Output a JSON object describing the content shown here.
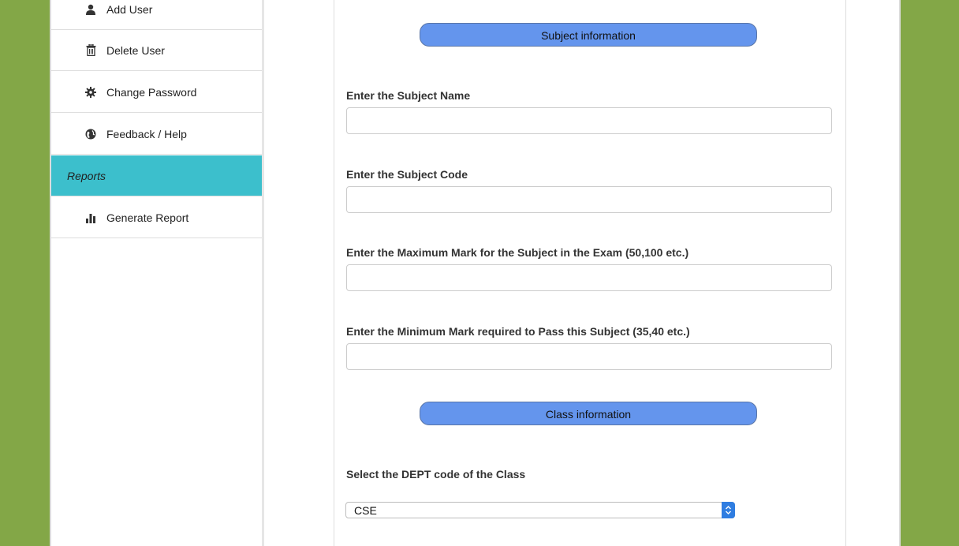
{
  "sidebar": {
    "items": [
      {
        "label": "Add User",
        "icon": "user-icon"
      },
      {
        "label": "Delete User",
        "icon": "trash-icon"
      },
      {
        "label": "Change Password",
        "icon": "gear-icon"
      },
      {
        "label": "Feedback / Help",
        "icon": "globe-icon"
      }
    ],
    "section_header": "Reports",
    "report_items": [
      {
        "label": "Generate Report",
        "icon": "bar-chart-icon"
      }
    ]
  },
  "form": {
    "subject_section_title": "Subject information",
    "subject_name_label": "Enter the Subject Name",
    "subject_code_label": "Enter the Subject Code",
    "max_mark_label": "Enter the Maximum Mark for the Subject in the Exam (50,100 etc.)",
    "min_mark_label": "Enter the Minimum Mark required to Pass this Subject (35,40 etc.)",
    "class_section_title": "Class information",
    "dept_label": "Select the DEPT code of the Class",
    "dept_selected": "CSE"
  },
  "colors": {
    "background": "#83a747",
    "active_section": "#3cbfcc",
    "pill": "#6495ed",
    "select_arrow": "#2f7de1"
  }
}
